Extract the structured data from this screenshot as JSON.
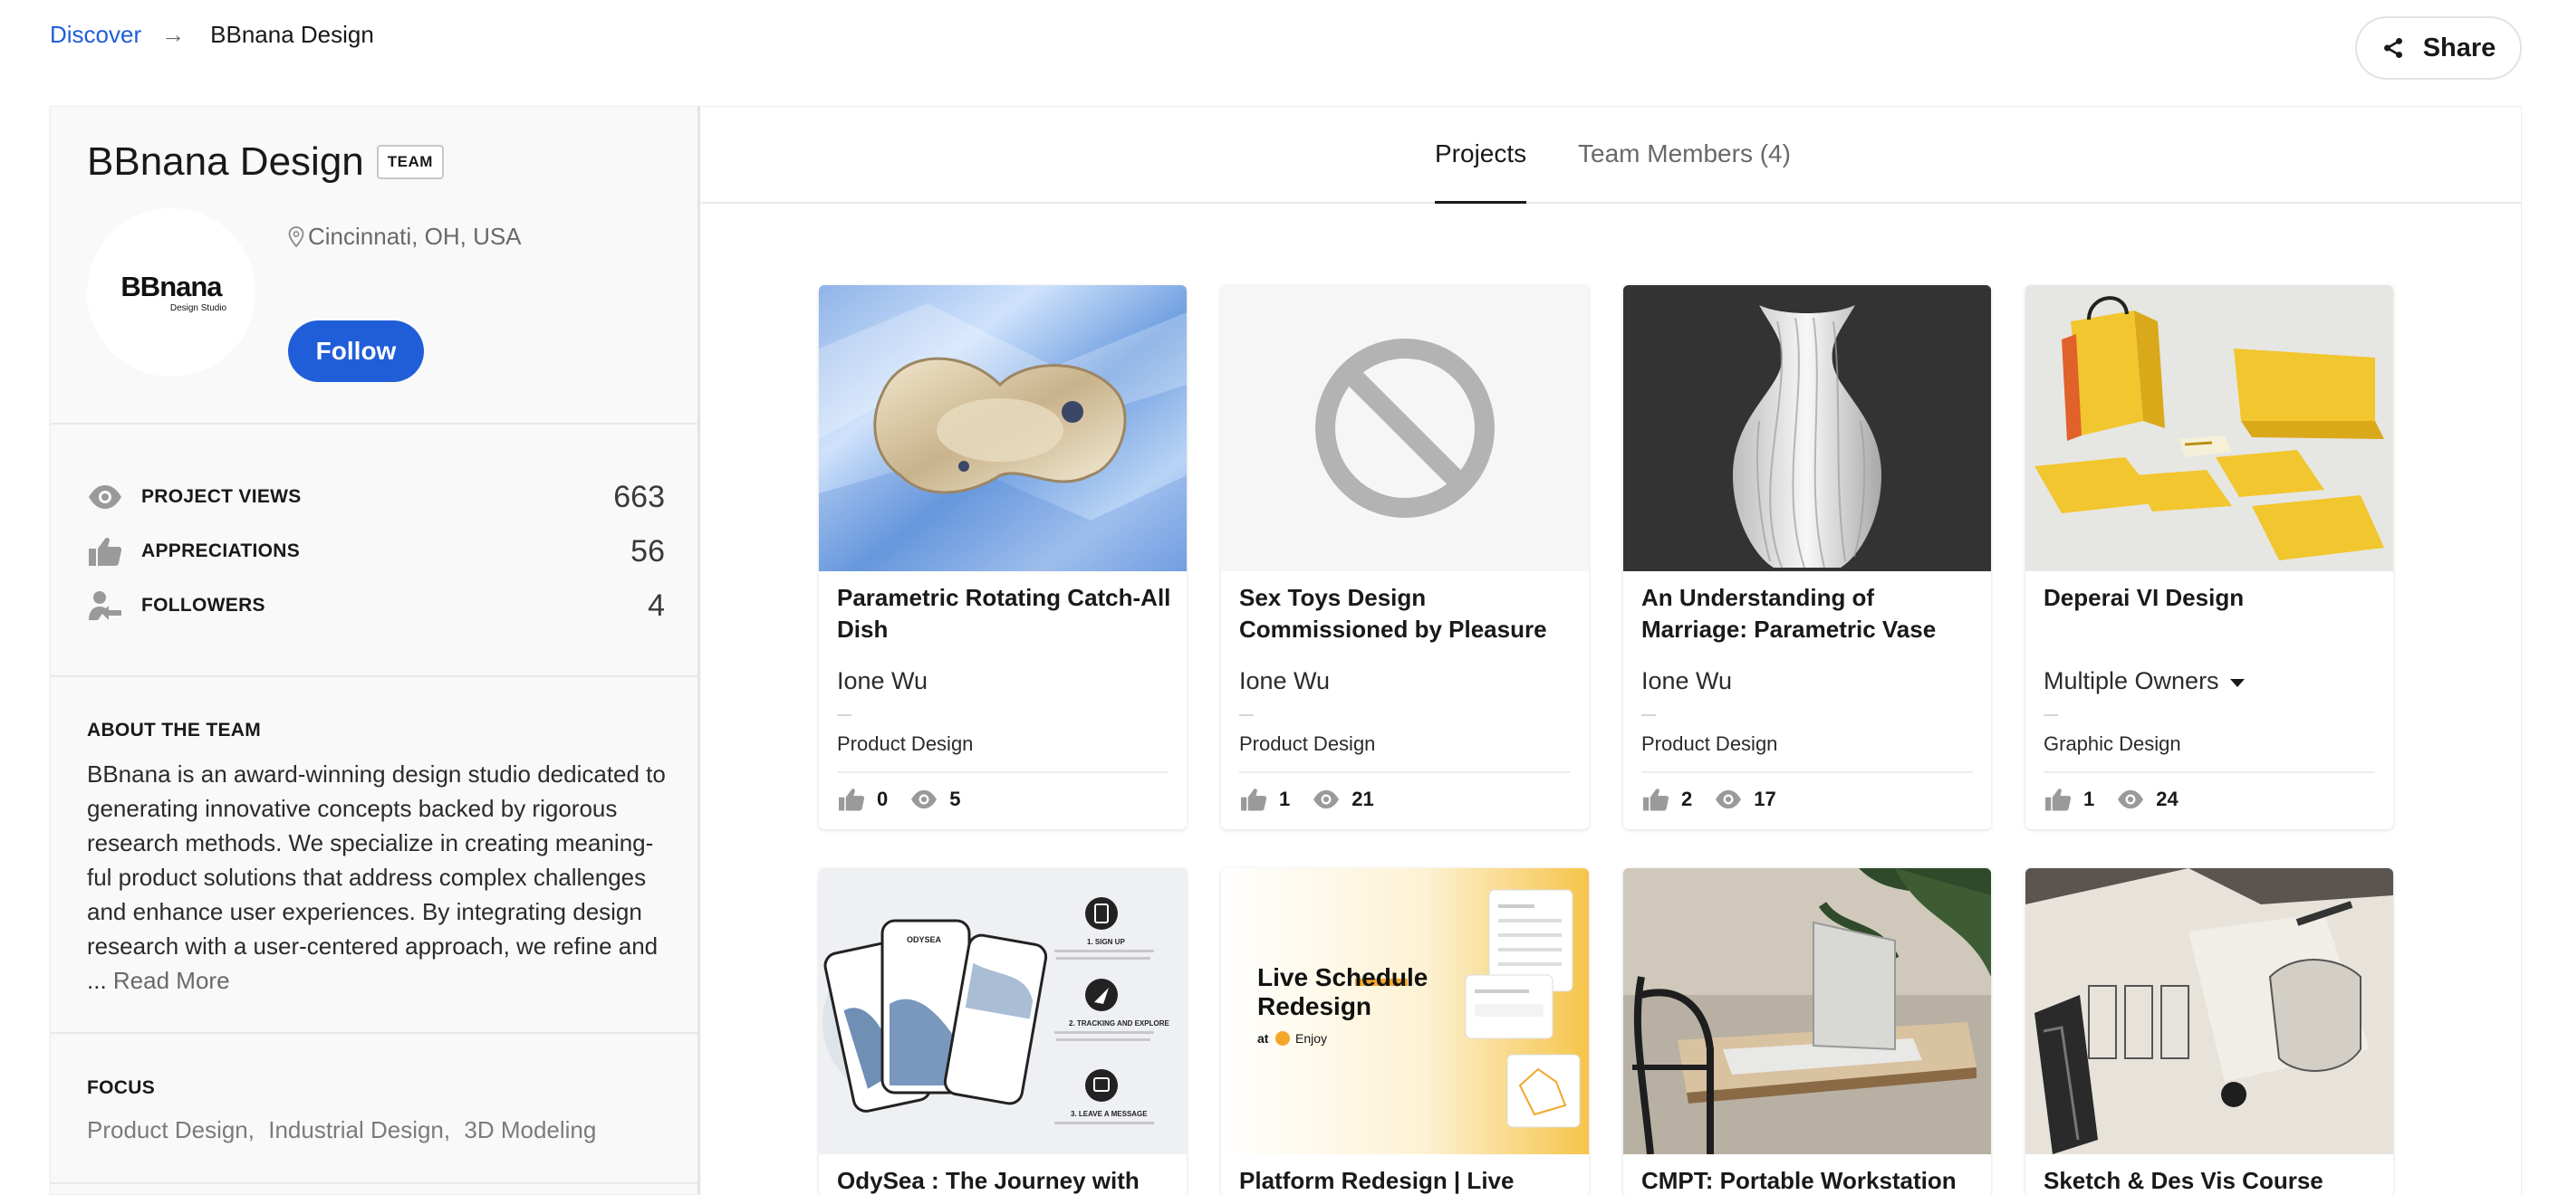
{
  "breadcrumb": {
    "parent": "Discover",
    "arrow": "→",
    "current": "BBnana Design"
  },
  "share": {
    "label": "Share"
  },
  "profile": {
    "name": "BBnana Design",
    "badge": "TEAM",
    "logo_text": "BBnana",
    "logo_sub": "Design Studio",
    "location": "Cincinnati, OH, USA",
    "follow_label": "Follow"
  },
  "stats": [
    {
      "label": "PROJECT VIEWS",
      "value": "663",
      "icon": "eye-icon"
    },
    {
      "label": "APPRECIATIONS",
      "value": "56",
      "icon": "thumbs-up-icon"
    },
    {
      "label": "FOLLOWERS",
      "value": "4",
      "icon": "follower-icon"
    }
  ],
  "about": {
    "title": "ABOUT THE TEAM",
    "text": "BBnana is an award-winning design studio dedicated to generating innovative concepts backed by rigorous research methods. We specialize in creating meaning-ful product solutions that address complex challenges and enhance user experiences. By integrating design research with a user-centered approach, we refine and ...",
    "read_more": "Read More"
  },
  "focus": {
    "title": "FOCUS",
    "items": [
      "Product Design",
      "Industrial Design",
      "3D Modeling"
    ],
    "separator": ","
  },
  "tabs": [
    {
      "label": "Projects",
      "active": true
    },
    {
      "label": "Team Members (4)",
      "active": false
    }
  ],
  "projects": [
    {
      "title": "Parametric Rotating Catch-All Dish",
      "owner": "Ione Wu",
      "field": "Product Design",
      "likes": "0",
      "views": "5"
    },
    {
      "title": "Sex Toys Design Commissioned by Pleasure",
      "owner": "Ione Wu",
      "field": "Product Design",
      "likes": "1",
      "views": "21"
    },
    {
      "title": "An Understanding of Marriage: Parametric Vase",
      "owner": "Ione Wu",
      "field": "Product Design",
      "likes": "2",
      "views": "17"
    },
    {
      "title": "Deperai VI Design",
      "owner": "Multiple Owners",
      "field": "Graphic Design",
      "likes": "1",
      "views": "24"
    },
    {
      "title": "OdySea : The Journey with",
      "owner": "",
      "field": "",
      "likes": "",
      "views": ""
    },
    {
      "title": "Platform Redesign | Live",
      "owner": "",
      "field": "",
      "likes": "",
      "views": ""
    },
    {
      "title": "CMPT: Portable Workstation",
      "owner": "",
      "field": "",
      "likes": "",
      "views": ""
    },
    {
      "title": "Sketch & Des Vis Course",
      "owner": "",
      "field": "",
      "likes": "",
      "views": ""
    }
  ],
  "thumb_text": {
    "schedule_title_1": "Live Schedule",
    "schedule_title_2": "Redesign",
    "schedule_at": "at",
    "schedule_brand": "Enjoy",
    "odysea_label": "ODYSEA",
    "odysea_step1": "1. SIGN UP",
    "odysea_step2": "2. TRACKING AND EXPLORE",
    "odysea_step3": "3. LEAVE A MESSAGE"
  },
  "colors": {
    "accent": "#1f5ed8",
    "text": "#191919",
    "muted": "#696969",
    "yellow": "#f4c21b"
  }
}
